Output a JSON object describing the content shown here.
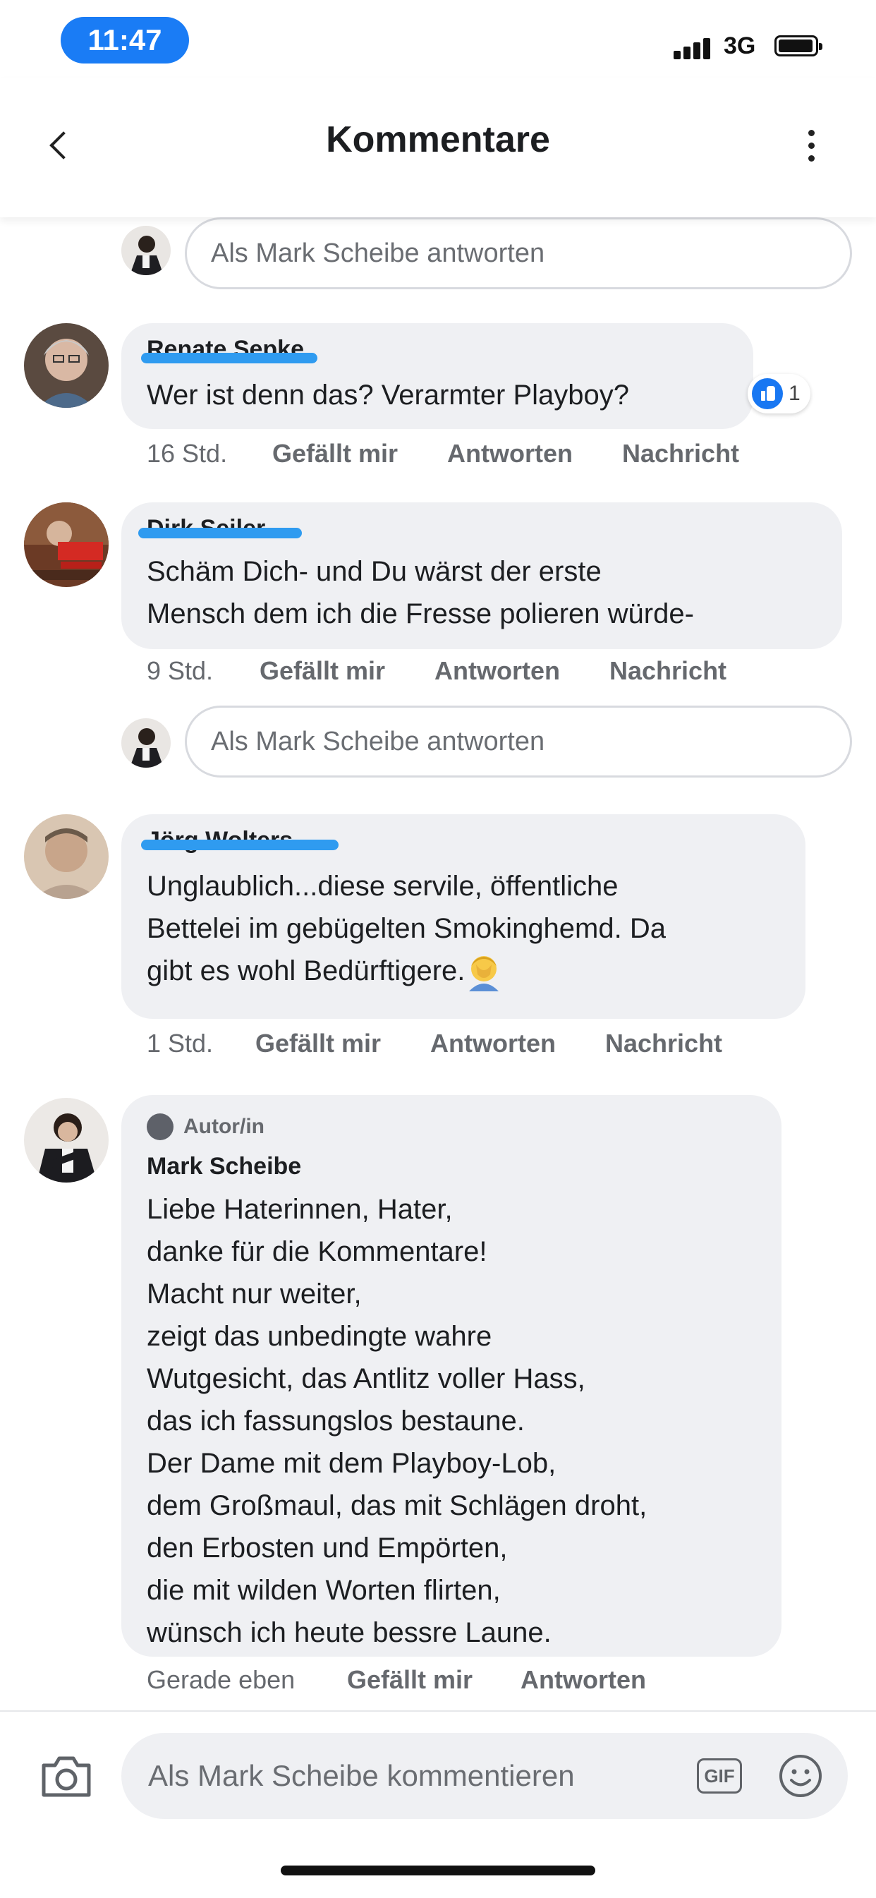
{
  "status_bar": {
    "time": "11:47",
    "network": "3G"
  },
  "header": {
    "title": "Kommentare"
  },
  "reply_placeholder": "Als Mark Scheibe antworten",
  "comments": [
    {
      "author": "Renate Sepke",
      "lines": [
        "Wer ist denn das? Verarmter Playboy?"
      ],
      "reactions": "1",
      "time": "16 Std.",
      "like_label": "Gefällt mir",
      "reply_label": "Antworten",
      "message_label": "Nachricht"
    },
    {
      "author": "Dirk Seiler",
      "lines": [
        "Schäm Dich- und Du wärst der erste",
        "Mensch dem ich die Fresse polieren würde-"
      ],
      "time": "9 Std.",
      "like_label": "Gefällt mir",
      "reply_label": "Antworten",
      "message_label": "Nachricht"
    },
    {
      "author": "Jörg Wolters",
      "lines": [
        "Unglaublich...diese servile, öffentliche",
        "Bettelei im gebügelten Smokinghemd. Da",
        "gibt es wohl Bedürftigere."
      ],
      "emoji": "facepalm-emoji",
      "time": "1 Std.",
      "like_label": "Gefällt mir",
      "reply_label": "Antworten",
      "message_label": "Nachricht"
    },
    {
      "badge": "Autor/in",
      "author": "Mark Scheibe",
      "lines": [
        "Liebe Haterinnen, Hater,",
        "danke für die Kommentare!",
        "Macht nur weiter,",
        "zeigt das unbedingte wahre",
        "Wutgesicht, das Antlitz voller Hass,",
        "das ich fassungslos bestaune.",
        "Der Dame mit dem Playboy-Lob,",
        "dem Großmaul, das mit Schlägen droht,",
        "den Erbosten und Empörten,",
        "die mit wilden Worten flirten,",
        "wünsch ich heute bessre Laune."
      ],
      "time": "Gerade eben",
      "like_label": "Gefällt mir",
      "reply_label": "Antworten"
    }
  ],
  "composer": {
    "placeholder": "Als Mark Scheibe kommentieren",
    "gif_label": "GIF"
  },
  "colors": {
    "accent": "#1877f2",
    "redaction": "#2f9bf0",
    "bubble": "#eff0f3",
    "status_pill": "#1a7cf5"
  }
}
